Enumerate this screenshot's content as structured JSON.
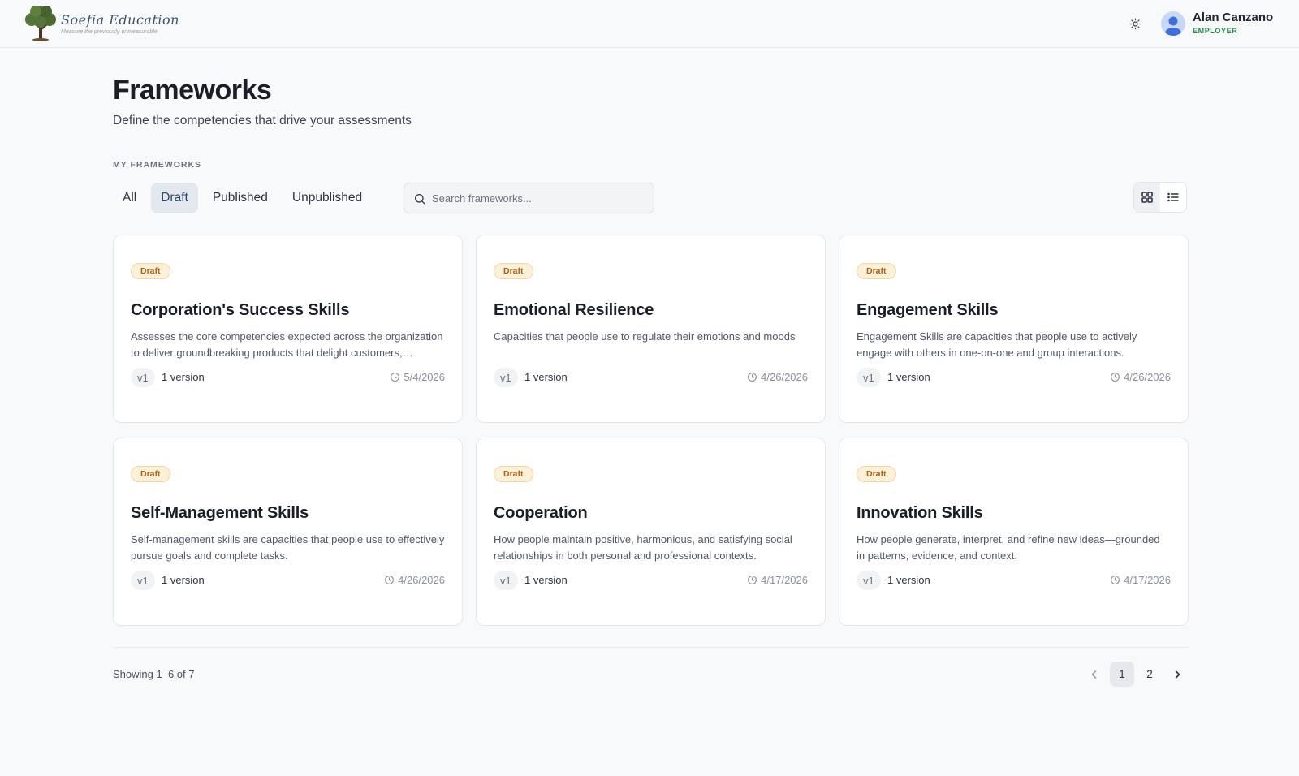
{
  "brand": {
    "name": "Soefia Education",
    "tagline": "Measure the previously unmeasurable"
  },
  "header": {
    "theme_icon": "sun-icon",
    "user": {
      "name": "Alan Canzano",
      "role": "EMPLOYER"
    }
  },
  "page": {
    "title": "Frameworks",
    "subtitle": "Define the competencies that drive your assessments",
    "section_label": "MY FRAMEWORKS"
  },
  "filters": {
    "tabs": [
      "All",
      "Draft",
      "Published",
      "Unpublished"
    ],
    "active_tab": "Draft",
    "search_placeholder": "Search frameworks...",
    "search_value": ""
  },
  "view_toggle": {
    "options": [
      "grid-icon",
      "list-icon"
    ],
    "active": "grid"
  },
  "frameworks": [
    {
      "status": "Draft",
      "title": "Corporation's Success Skills",
      "description": "Assesses the core competencies expected across the organization to deliver groundbreaking products that delight customers, operating with integrity and excellence.",
      "version_tag": "v1",
      "versions": "1 version",
      "date": "5/4/2026"
    },
    {
      "status": "Draft",
      "title": "Emotional Resilience",
      "description": "Capacities that people use to regulate their emotions and moods",
      "version_tag": "v1",
      "versions": "1 version",
      "date": "4/26/2026"
    },
    {
      "status": "Draft",
      "title": "Engagement Skills",
      "description": "Engagement Skills are capacities that people use to actively engage with others in one-on-one and group interactions.",
      "version_tag": "v1",
      "versions": "1 version",
      "date": "4/26/2026"
    },
    {
      "status": "Draft",
      "title": "Self-Management Skills",
      "description": "Self-management skills are capacities that people use to effectively pursue goals and complete tasks.",
      "version_tag": "v1",
      "versions": "1 version",
      "date": "4/26/2026"
    },
    {
      "status": "Draft",
      "title": "Cooperation",
      "description": "How people maintain positive, harmonious, and satisfying social relationships in both personal and professional contexts.",
      "version_tag": "v1",
      "versions": "1 version",
      "date": "4/17/2026"
    },
    {
      "status": "Draft",
      "title": "Innovation Skills",
      "description": "How people generate, interpret, and refine new ideas—grounded in patterns, evidence, and context.",
      "version_tag": "v1",
      "versions": "1 version",
      "date": "4/17/2026"
    }
  ],
  "pagination": {
    "showing": "Showing 1–6 of 7",
    "pages": [
      "1",
      "2"
    ],
    "current": "1"
  },
  "colors": {
    "accent": "#2d4567",
    "draft_badge_bg": "#fdf0d9",
    "draft_badge_text": "#a6621a",
    "role_green": "#23874f"
  }
}
